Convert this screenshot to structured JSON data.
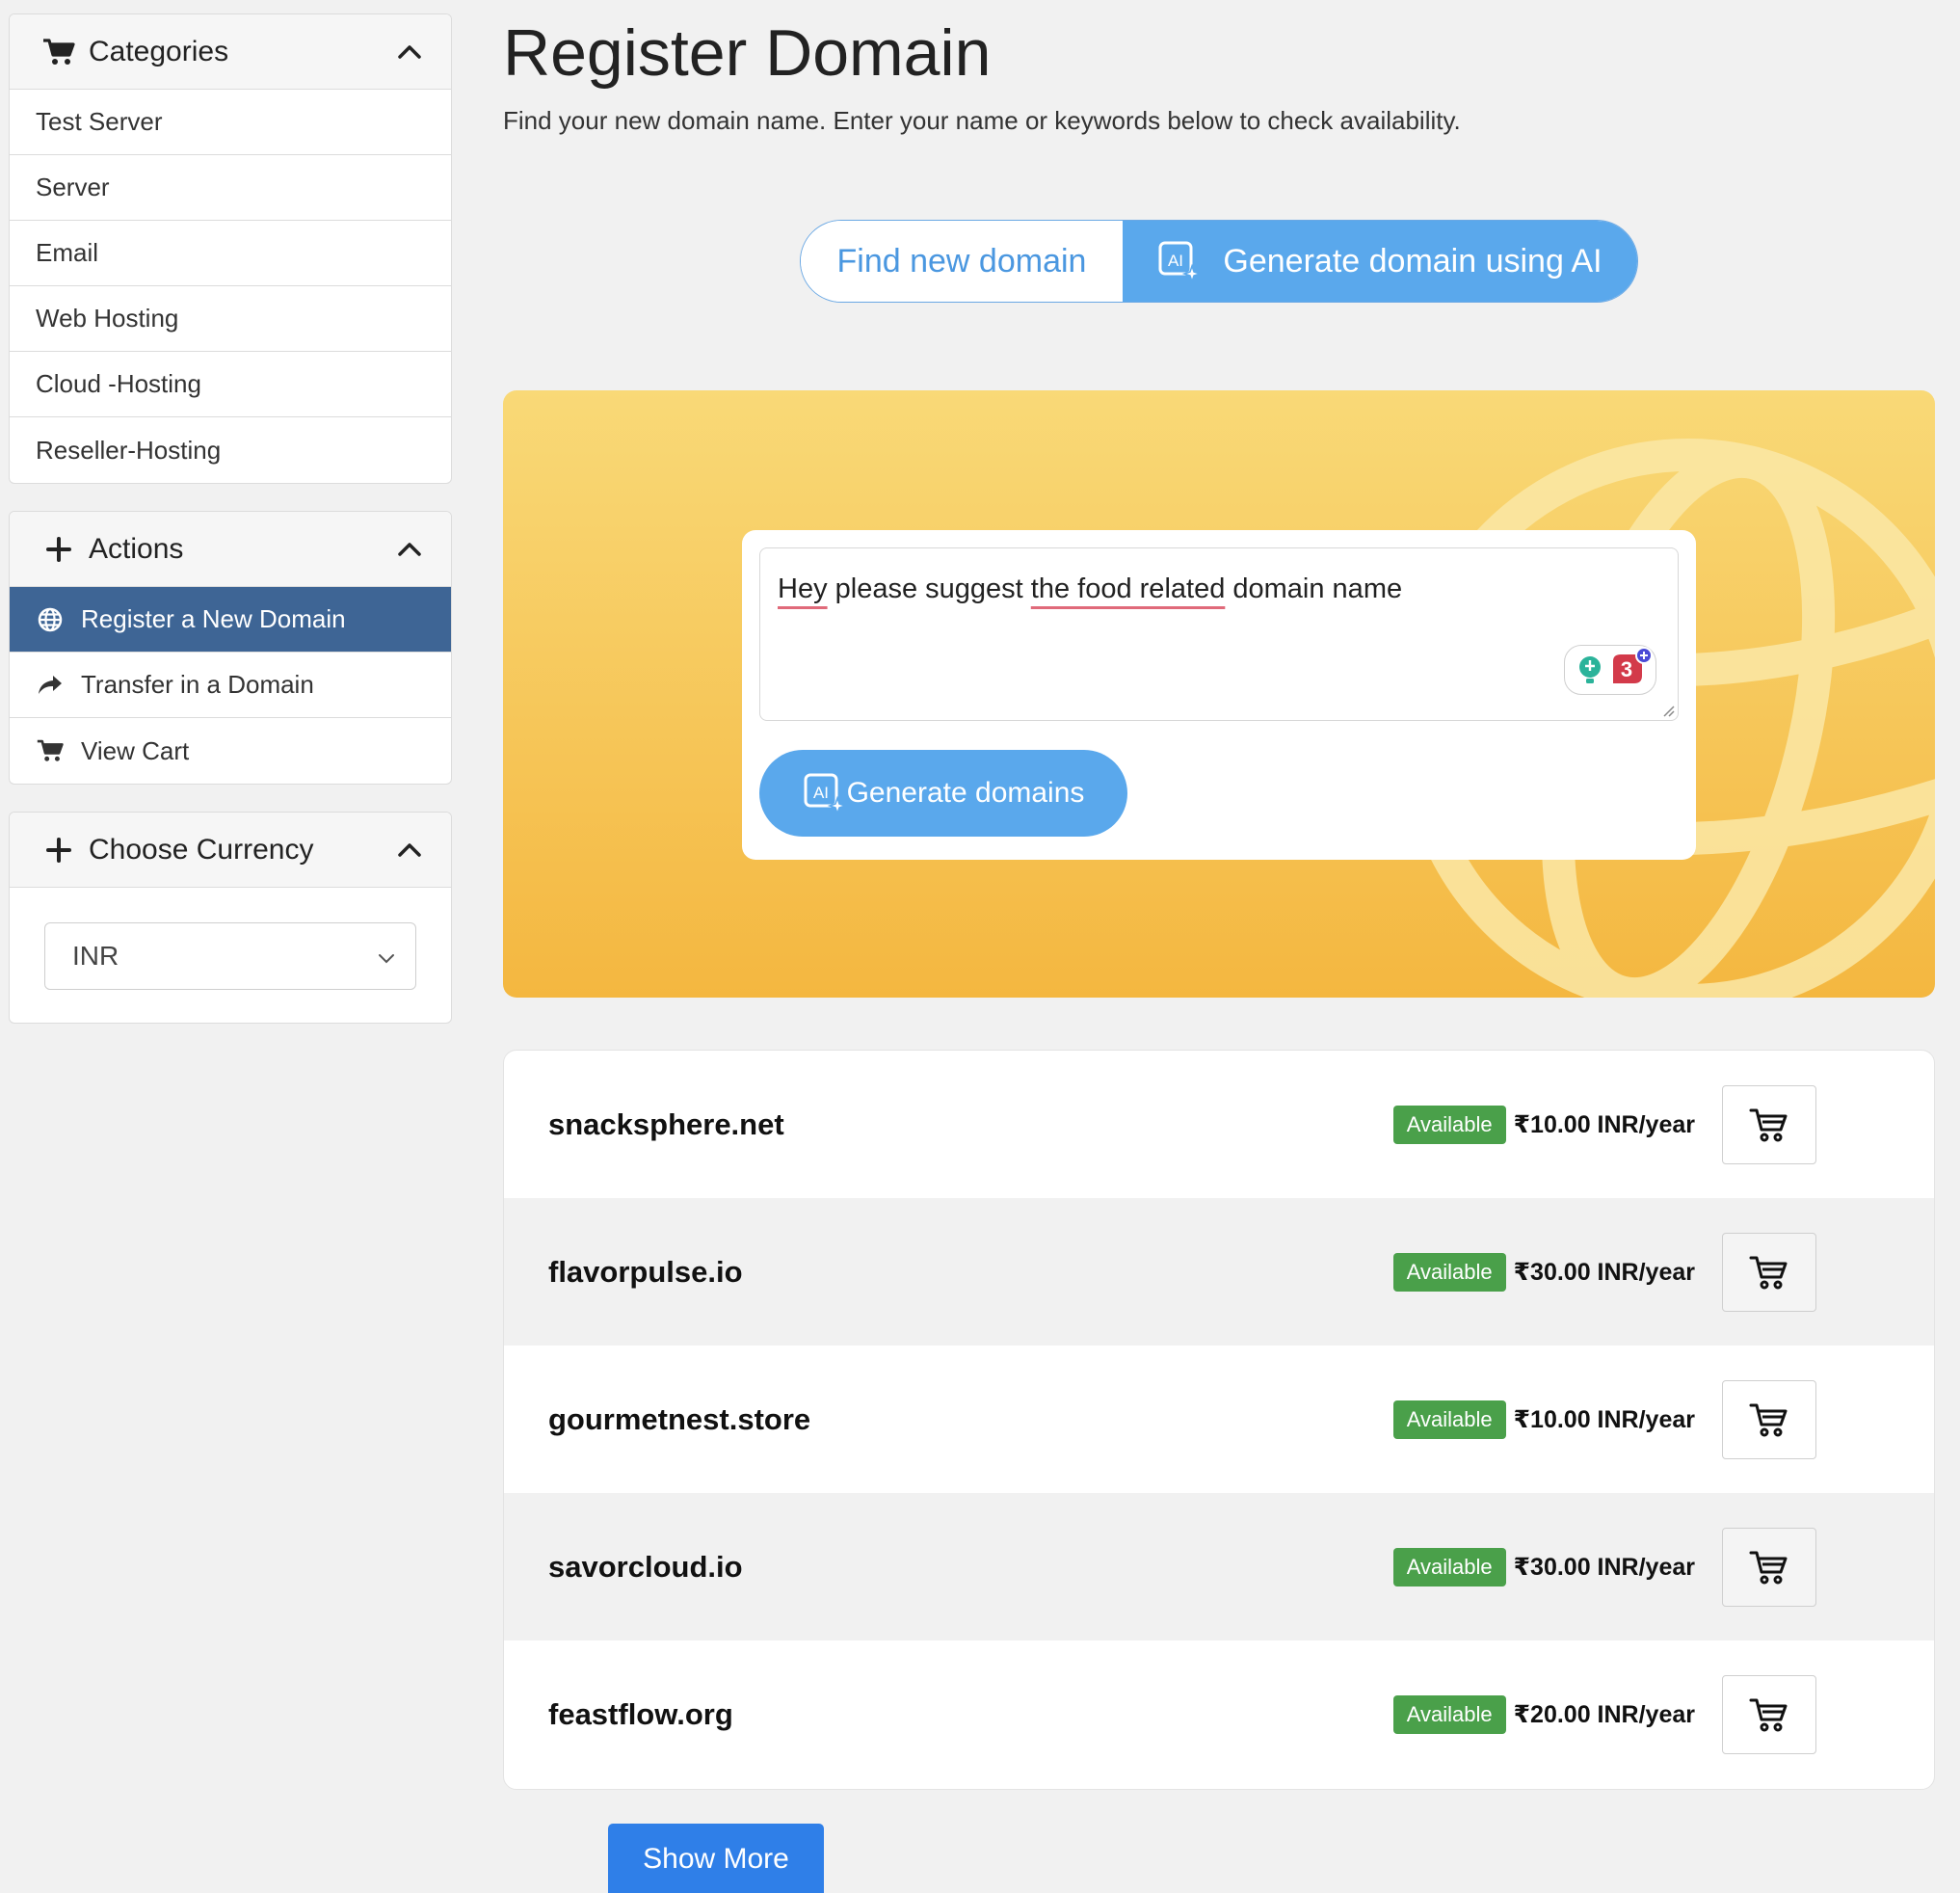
{
  "sidebar": {
    "categories": {
      "title": "Categories",
      "items": [
        {
          "label": "Test Server"
        },
        {
          "label": "Server"
        },
        {
          "label": "Email"
        },
        {
          "label": "Web Hosting"
        },
        {
          "label": "Cloud -Hosting"
        },
        {
          "label": "Reseller-Hosting"
        }
      ]
    },
    "actions": {
      "title": "Actions",
      "items": [
        {
          "label": "Register a New Domain",
          "icon": "globe-icon",
          "active": true
        },
        {
          "label": "Transfer in a Domain",
          "icon": "share-arrow-icon",
          "active": false
        },
        {
          "label": "View Cart",
          "icon": "cart-icon",
          "active": false
        }
      ]
    },
    "currency": {
      "title": "Choose Currency",
      "selected": "INR"
    }
  },
  "main": {
    "title": "Register Domain",
    "subtitle": "Find your new domain name. Enter your name or keywords below to check availability.",
    "toggle": {
      "find_label": "Find new domain",
      "ai_label": "Generate domain using AI"
    },
    "prompt": {
      "words": [
        "Hey",
        " please suggest ",
        "the food related",
        " domain name"
      ],
      "grammar_count": "3",
      "generate_label": "Generate domains"
    },
    "results": [
      {
        "domain": "snacksphere.net",
        "status": "Available",
        "price": "₹10.00 INR/year"
      },
      {
        "domain": "flavorpulse.io",
        "status": "Available",
        "price": "₹30.00 INR/year"
      },
      {
        "domain": "gourmetnest.store",
        "status": "Available",
        "price": "₹10.00 INR/year"
      },
      {
        "domain": "savorcloud.io",
        "status": "Available",
        "price": "₹30.00 INR/year"
      },
      {
        "domain": "feastflow.org",
        "status": "Available",
        "price": "₹20.00 INR/year"
      }
    ],
    "show_more_label": "Show More"
  },
  "colors": {
    "active_nav": "#3e6595",
    "ai_blue": "#5aa8ec",
    "available_green": "#4aa04a",
    "show_more_blue": "#2f7fe8",
    "hero_top": "#f9d977",
    "hero_bottom": "#f4b740"
  }
}
